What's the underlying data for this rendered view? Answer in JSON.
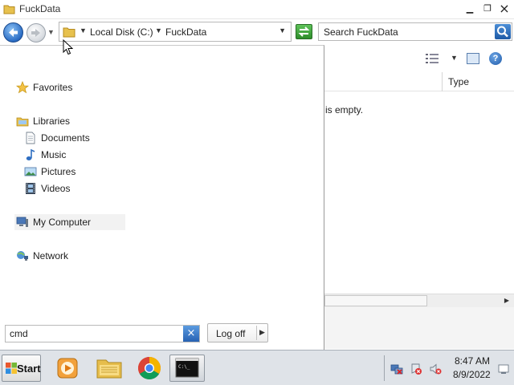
{
  "window": {
    "title": "FuckData",
    "breadcrumb": [
      "Local Disk (C:)",
      "FuckData"
    ],
    "search_placeholder": "Search FuckData",
    "column_type": "Type",
    "empty_message": "is empty."
  },
  "start_menu": {
    "favorites": "Favorites",
    "libraries": "Libraries",
    "library_items": [
      "Documents",
      "Music",
      "Pictures",
      "Videos"
    ],
    "my_computer": "My Computer",
    "network": "Network",
    "search_value": "cmd",
    "logoff_label": "Log off"
  },
  "taskbar": {
    "start_label": "Start",
    "clock_time": "8:47 AM",
    "clock_date": "8/9/2022"
  },
  "colors": {
    "accent": "#2a6cc4",
    "taskbar": "#dfe3e8"
  }
}
